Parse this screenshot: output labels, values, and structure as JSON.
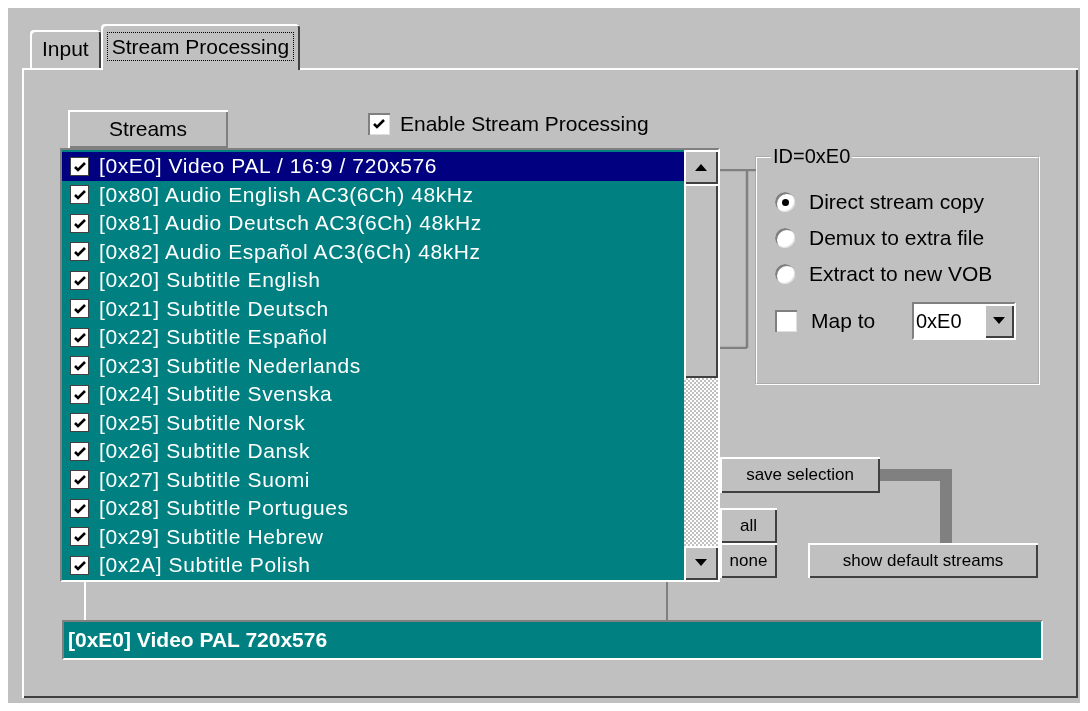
{
  "tabs": [
    {
      "label": "Input",
      "selected": false
    },
    {
      "label": "Stream Processing",
      "selected": true
    }
  ],
  "streams_header": "Streams",
  "enable_stream_processing": {
    "label": "Enable Stream Processing",
    "checked": true
  },
  "streams": [
    {
      "label": "[0xE0] Video PAL / 16:9 / 720x576",
      "checked": true,
      "selected": true
    },
    {
      "label": "[0x80] Audio English AC3(6Ch) 48kHz",
      "checked": true,
      "selected": false
    },
    {
      "label": "[0x81] Audio Deutsch AC3(6Ch) 48kHz",
      "checked": true,
      "selected": false
    },
    {
      "label": "[0x82] Audio Español AC3(6Ch) 48kHz",
      "checked": true,
      "selected": false
    },
    {
      "label": "[0x20] Subtitle English",
      "checked": true,
      "selected": false
    },
    {
      "label": "[0x21] Subtitle Deutsch",
      "checked": true,
      "selected": false
    },
    {
      "label": "[0x22] Subtitle Español",
      "checked": true,
      "selected": false
    },
    {
      "label": "[0x23] Subtitle Nederlands",
      "checked": true,
      "selected": false
    },
    {
      "label": "[0x24] Subtitle Svenska",
      "checked": true,
      "selected": false
    },
    {
      "label": "[0x25] Subtitle Norsk",
      "checked": true,
      "selected": false
    },
    {
      "label": "[0x26] Subtitle Dansk",
      "checked": true,
      "selected": false
    },
    {
      "label": "[0x27] Subtitle Suomi",
      "checked": true,
      "selected": false
    },
    {
      "label": "[0x28] Subtitle Portugues",
      "checked": true,
      "selected": false
    },
    {
      "label": "[0x29] Subtitle Hebrew",
      "checked": true,
      "selected": false
    },
    {
      "label": "[0x2A] Subtitle Polish",
      "checked": true,
      "selected": false
    }
  ],
  "stream_options": {
    "title": "ID=0xE0",
    "modes": [
      {
        "label": "Direct stream copy",
        "selected": true
      },
      {
        "label": "Demux to extra file",
        "selected": false
      },
      {
        "label": "Extract to new VOB",
        "selected": false
      }
    ],
    "map_to": {
      "label": "Map to",
      "checked": false,
      "value": "0xE0"
    }
  },
  "save_selection": "save selection",
  "select_all": "all",
  "select_none": "none",
  "show_default_streams": "show default streams",
  "status": "[0xE0] Video PAL 720x576"
}
